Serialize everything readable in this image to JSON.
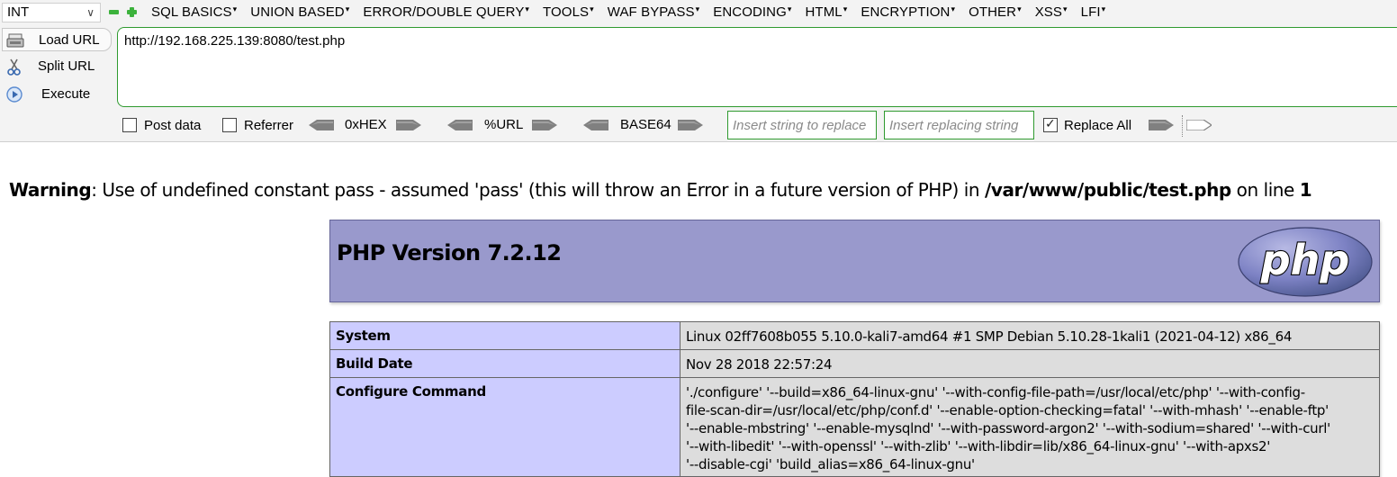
{
  "hackbar": {
    "type_select": "INT",
    "menu": [
      "SQL BASICS",
      "UNION BASED",
      "ERROR/DOUBLE QUERY",
      "TOOLS",
      "WAF BYPASS",
      "ENCODING",
      "HTML",
      "ENCRYPTION",
      "OTHER",
      "XSS",
      "LFI"
    ],
    "load_url": "Load URL",
    "split_url": "Split URL",
    "execute": "Execute",
    "url": "http://192.168.225.139:8080/test.php",
    "post_data": "Post data",
    "referrer": "Referrer",
    "hex": "0xHEX",
    "url_enc": "%URL",
    "base64": "BASE64",
    "replace_from_placeholder": "Insert string to replace",
    "replace_to_placeholder": "Insert replacing string",
    "replace_all": "Replace All",
    "replace_all_checked": true
  },
  "warning": {
    "label": "Warning",
    "message": ": Use of undefined constant pass - assumed 'pass' (this will throw an Error in a future version of PHP) in ",
    "file": "/var/www/public/test.php",
    "on_line": " on line ",
    "line": "1"
  },
  "phpinfo": {
    "title": "PHP Version 7.2.12",
    "logo_text": "php",
    "rows": [
      {
        "key": "System",
        "value": "Linux 02ff7608b055 5.10.0-kali7-amd64 #1 SMP Debian 5.10.28-1kali1 (2021-04-12) x86_64"
      },
      {
        "key": "Build Date",
        "value": "Nov 28 2018 22:57:24"
      },
      {
        "key": "Configure Command",
        "value_lines": [
          "'./configure' '--build=x86_64-linux-gnu' '--with-config-file-path=/usr/local/etc/php' '--with-config-",
          "file-scan-dir=/usr/local/etc/php/conf.d' '--enable-option-checking=fatal' '--with-mhash' '--enable-ftp'",
          "'--enable-mbstring' '--enable-mysqlnd' '--with-password-argon2' '--with-sodium=shared' '--with-curl'",
          "'--with-libedit' '--with-openssl' '--with-zlib' '--with-libdir=lib/x86_64-linux-gnu' '--with-apxs2'",
          "'--disable-cgi' 'build_alias=x86_64-linux-gnu'"
        ]
      }
    ]
  }
}
